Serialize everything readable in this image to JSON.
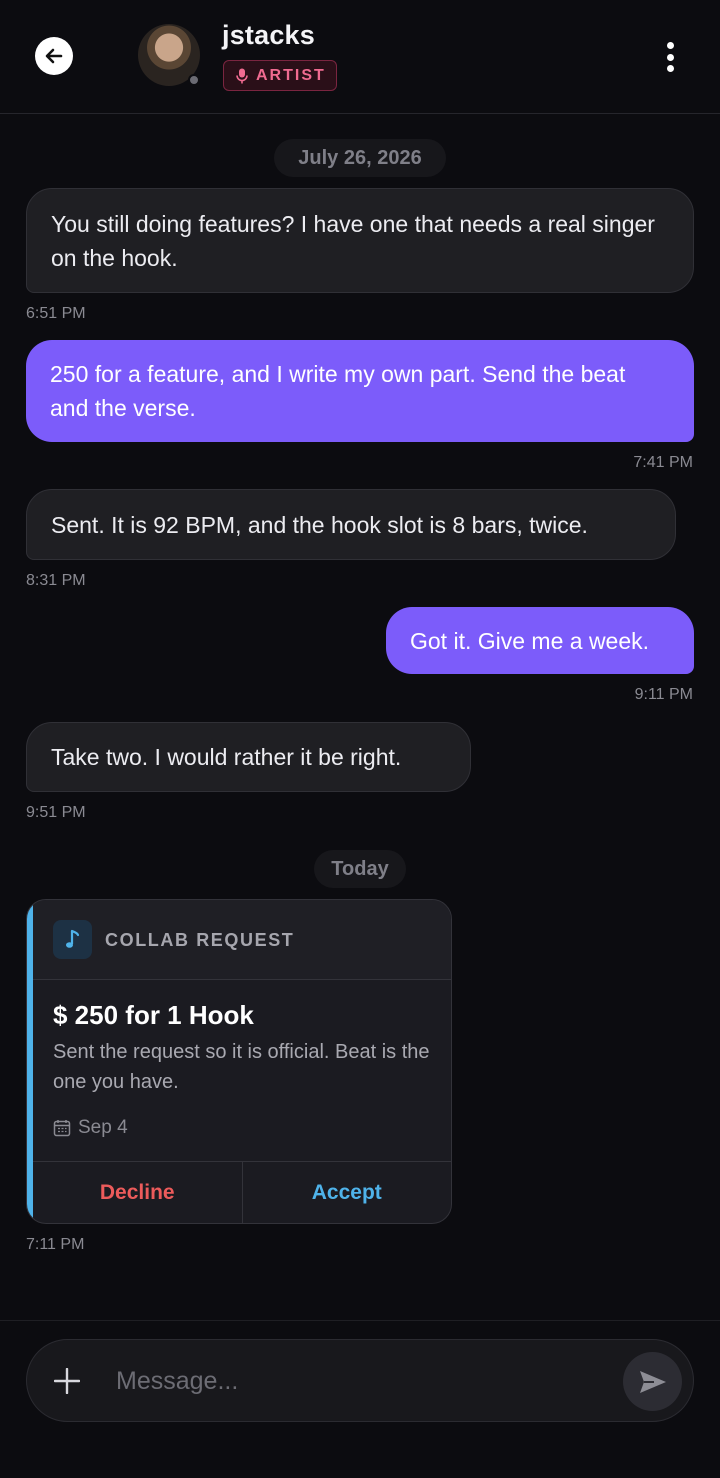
{
  "header": {
    "username": "jstacks",
    "badge": "ARTIST"
  },
  "thread": {
    "date_1": "July 26, 2026",
    "messages": [
      {
        "direction": "incoming",
        "text": "You still doing features? I have one that needs a real singer on the hook.",
        "time": "6:51 PM"
      },
      {
        "direction": "outgoing",
        "text": "250 for a feature, and I write my own part. Send the beat and the verse.",
        "time": "7:41 PM"
      },
      {
        "direction": "incoming",
        "text": "Sent. It is 92 BPM, and the hook slot is 8 bars, twice.",
        "time": "8:31 PM"
      },
      {
        "direction": "outgoing",
        "text": "Got it. Give me a week.",
        "time": "9:11 PM"
      },
      {
        "direction": "incoming",
        "text": "Take two. I would rather it be right.",
        "time": "9:51 PM"
      }
    ],
    "date_2": "Today",
    "collab": {
      "label": "COLLAB REQUEST",
      "title": "$ 250 for 1 Hook",
      "body": "Sent the request so it is official. Beat is the one you have.",
      "date": "Sep 4",
      "decline": "Decline",
      "accept": "Accept",
      "time": "7:11 PM"
    }
  },
  "composer": {
    "placeholder": "Message..."
  },
  "colors": {
    "background": "#0c0c10",
    "outgoing_bubble": "#7c5cfa",
    "incoming_bubble": "#1f1f23",
    "badge": "#f06b91",
    "accent": "#4fb3ea",
    "decline": "#ec5b5b"
  },
  "icons": [
    "back-arrow-icon",
    "microphone-icon",
    "more-vertical-icon",
    "music-note-icon",
    "calendar-icon",
    "plus-icon",
    "send-icon"
  ]
}
